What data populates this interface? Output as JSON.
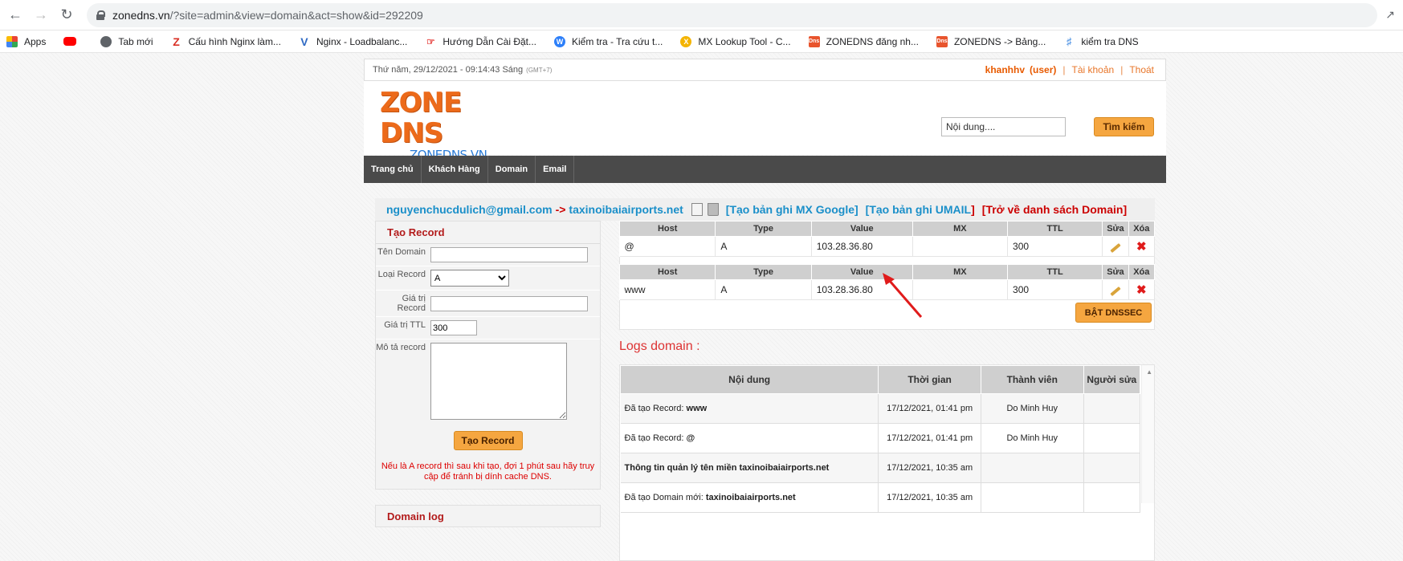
{
  "browser": {
    "url_host": "zonedns.vn",
    "url_rest": "/?site=admin&view=domain&act=show&id=292209",
    "bookmarks": [
      {
        "label": "Apps",
        "icon": "apps-icon"
      },
      {
        "label": "",
        "icon": "youtube-icon"
      },
      {
        "label": "Tab mới",
        "icon": "globe-icon"
      },
      {
        "label": "Cấu hình Nginx làm...",
        "icon": "z-site-icon"
      },
      {
        "label": "Nginx - Loadbalanc...",
        "icon": "v-site-icon"
      },
      {
        "label": "Hướng Dẫn Cài Đặt...",
        "icon": "hand-site-icon"
      },
      {
        "label": "Kiểm tra - Tra cứu t...",
        "icon": "w-site-icon"
      },
      {
        "label": "MX Lookup Tool - C...",
        "icon": "mx-site-icon"
      },
      {
        "label": "ZONEDNS đăng nh...",
        "icon": "dns-site-icon"
      },
      {
        "label": "ZONEDNS -> Bảng...",
        "icon": "dns-site-icon"
      },
      {
        "label": "kiểm tra DNS",
        "icon": "key-site-icon"
      }
    ]
  },
  "topbar": {
    "datetime": "Thứ năm, 29/12/2021 - 09:14:43 Sáng",
    "gmt": "(GMT+7)",
    "username": "khanhhv",
    "role": "(user)",
    "account": "Tài khoản",
    "logout": "Thoát",
    "sep": "|"
  },
  "header": {
    "logo_main": "ZONE DNS",
    "logo_sub": "ZONEDNS.VN",
    "search_placeholder": "Nội dung....",
    "search_button": "Tìm kiếm"
  },
  "menu": [
    "Trang chủ",
    "Khách Hàng",
    "Domain",
    "Email"
  ],
  "crumb": {
    "email": "nguyenchucdulich@gmail.com",
    "arrow": "->",
    "domain": "taxinoibaiairports.net",
    "link_mx": "[Tạo bản ghi MX Google]",
    "link_umail": "[Tạo bản ghi UMAIL",
    "bracket": "]",
    "link_back": "[Trở về danh sách Domain]"
  },
  "form": {
    "title": "Tạo Record",
    "label_name": "Tên Domain",
    "label_type": "Loại Record",
    "type_value": "A",
    "label_value": "Giá trị Record",
    "label_ttl": "Giá trị TTL",
    "ttl_value": "300",
    "label_desc": "Mô tả record",
    "submit": "Tạo Record",
    "notice": "Nếu là A record thì sau khi tạo, đợi 1 phút sau hãy truy cập để tránh bị dính cache DNS."
  },
  "domain_log_title": "Domain log",
  "records": {
    "headers": [
      "Host",
      "Type",
      "Value",
      "MX",
      "TTL",
      "Sửa",
      "Xóa"
    ],
    "rows": [
      {
        "host": "@",
        "type": "A",
        "value": "103.28.36.80",
        "mx": "",
        "ttl": "300"
      },
      {
        "host": "www",
        "type": "A",
        "value": "103.28.36.80",
        "mx": "",
        "ttl": "300"
      }
    ]
  },
  "dnssec_button": "BẬT DNSSEC",
  "logs": {
    "title": "Logs domain :",
    "headers": [
      "Nội dung",
      "Thời gian",
      "Thành viên",
      "Người sửa"
    ],
    "rows": [
      {
        "prefix": "Đã tạo Record: ",
        "bold": "www",
        "time": "17/12/2021, 01:41 pm",
        "member": "Do Minh Huy",
        "editor": ""
      },
      {
        "prefix": "Đã tạo Record: ",
        "bold": "@",
        "time": "17/12/2021, 01:41 pm",
        "member": "Do Minh Huy",
        "editor": ""
      },
      {
        "prefix": "",
        "bold": "Thông tin quản lý tên miền taxinoibaiairports.net",
        "time": "17/12/2021, 10:35 am",
        "member": "",
        "editor": ""
      },
      {
        "prefix": "Đã tạo Domain mới: ",
        "bold": "taxinoibaiairports.net",
        "time": "17/12/2021, 10:35 am",
        "member": "",
        "editor": ""
      }
    ]
  },
  "colors": {
    "accent_orange": "#f5a640",
    "link_blue": "#1a8fc9",
    "title_red": "#b31b1b",
    "menu_dark": "#4a4a4a"
  }
}
